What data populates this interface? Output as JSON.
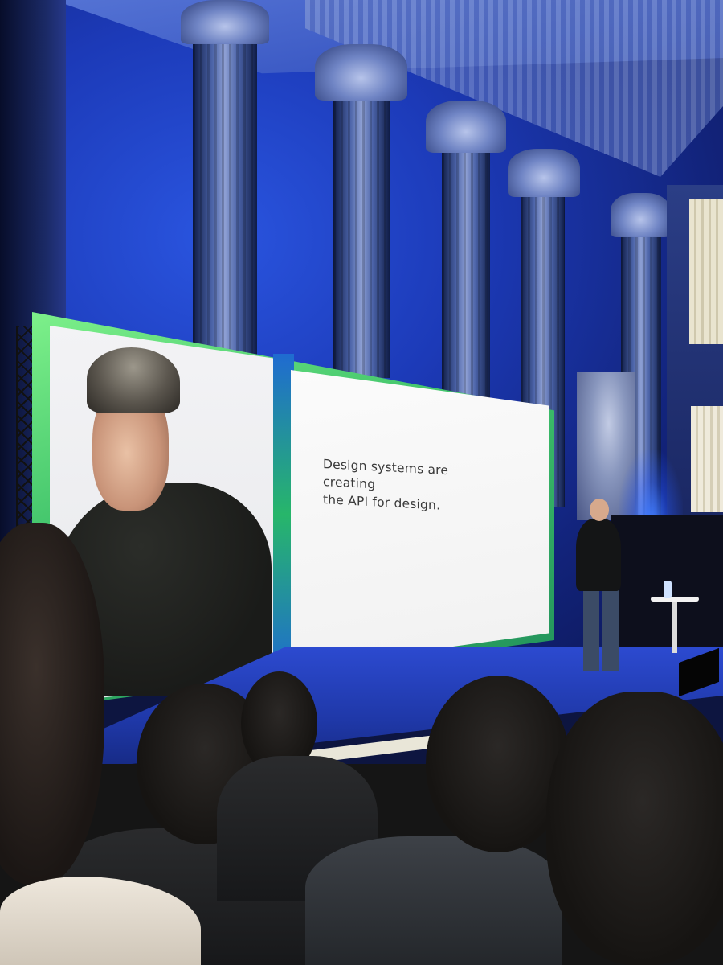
{
  "slide": {
    "line1": "Design systems are creating",
    "line2": "the API for design."
  }
}
